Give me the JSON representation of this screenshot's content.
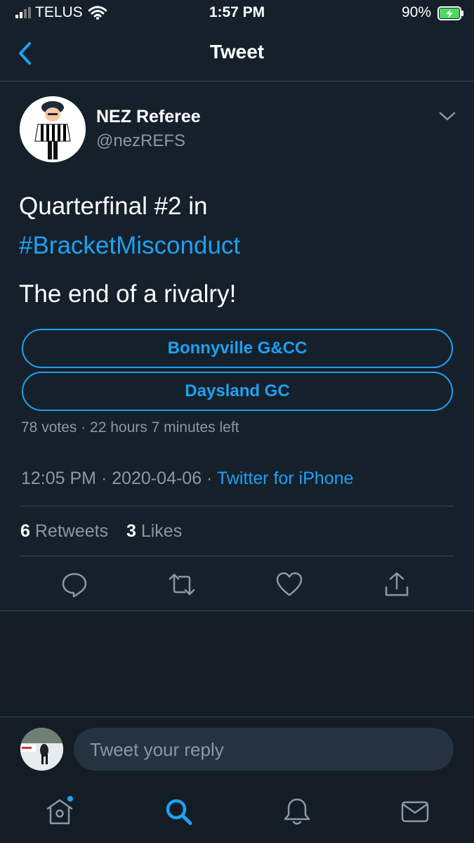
{
  "status_bar": {
    "carrier": "TELUS",
    "time": "1:57 PM",
    "battery": "90%"
  },
  "nav": {
    "title": "Tweet",
    "back_icon": "chevron-left-icon"
  },
  "tweet": {
    "author_name": "NEZ Referee",
    "author_handle": "@nezREFS",
    "text_line1": "Quarterfinal #2 in",
    "hashtag": "#BracketMisconduct",
    "text_line3": "The end of a rivalry!",
    "poll": {
      "options": [
        "Bonnyville G&CC",
        "Daysland GC"
      ],
      "summary": "78 votes · 22 hours 7 minutes left"
    },
    "timestamp": "12:05 PM · 2020-04-06 · ",
    "source": "Twitter for iPhone",
    "retweets_count": "6",
    "retweets_label": "Retweets",
    "likes_count": "3",
    "likes_label": "Likes"
  },
  "reply": {
    "placeholder": "Tweet your reply"
  },
  "colors": {
    "background": "#15202b",
    "accent": "#1da1f2",
    "muted": "#8899a6",
    "divider": "#38444d"
  }
}
